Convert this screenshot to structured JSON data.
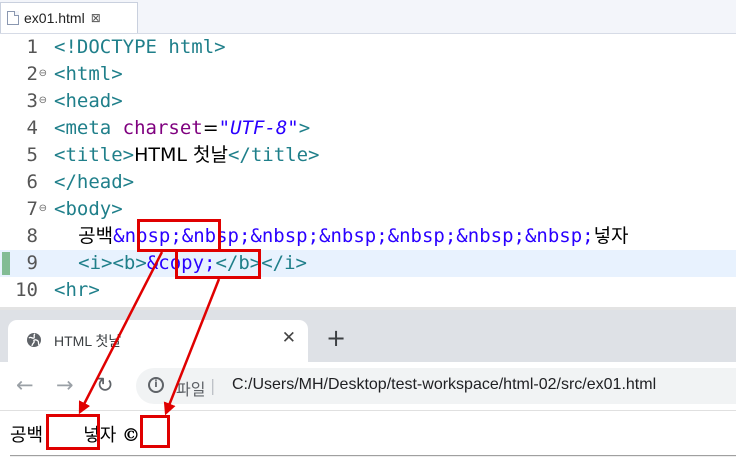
{
  "editor": {
    "tab": {
      "title": "ex01.html",
      "close": "⊠"
    },
    "lines": [
      {
        "num": "1",
        "tokens": [
          {
            "t": "<!DOCTYPE html>",
            "c": "tag"
          }
        ]
      },
      {
        "num": "2",
        "fold": true,
        "tokens": [
          {
            "t": "<html>",
            "c": "tag"
          }
        ]
      },
      {
        "num": "3",
        "fold": true,
        "tokens": [
          {
            "t": "<head>",
            "c": "tag"
          }
        ]
      },
      {
        "num": "4",
        "tokens": [
          {
            "t": "<meta ",
            "c": "tag"
          },
          {
            "t": "charset",
            "c": "attr"
          },
          {
            "t": "=",
            "c": "txt"
          },
          {
            "t": "\"UTF-8\"",
            "c": "val"
          },
          {
            "t": ">",
            "c": "tag"
          }
        ]
      },
      {
        "num": "5",
        "tokens": [
          {
            "t": "<title>",
            "c": "tag"
          },
          {
            "t": "HTML 첫날",
            "c": "txt"
          },
          {
            "t": "</title>",
            "c": "tag"
          }
        ]
      },
      {
        "num": "6",
        "tokens": [
          {
            "t": "</head>",
            "c": "tag"
          }
        ]
      },
      {
        "num": "7",
        "fold": true,
        "tokens": [
          {
            "t": "<body>",
            "c": "tag"
          }
        ]
      },
      {
        "num": "8",
        "tokens": [
          {
            "t": "    ",
            "c": "txt"
          },
          {
            "t": "공백",
            "c": "txt"
          },
          {
            "t": "&nbsp;&nbsp;&nbsp;&nbsp;&nbsp;&nbsp;&nbsp;",
            "c": "ent"
          },
          {
            "t": "넣자",
            "c": "txt"
          }
        ]
      },
      {
        "num": "9",
        "current": true,
        "marker": true,
        "tokens": [
          {
            "t": "    ",
            "c": "txt"
          },
          {
            "t": "<i><b>",
            "c": "tag"
          },
          {
            "t": "&copy;",
            "c": "ent"
          },
          {
            "t": "</b></i>",
            "c": "tag"
          }
        ]
      },
      {
        "num": "10",
        "tokens": [
          {
            "t": "<hr>",
            "c": "tag"
          }
        ]
      }
    ]
  },
  "browser": {
    "tab": {
      "title": "HTML 첫날",
      "close": "✕"
    },
    "new_tab": "+",
    "nav": {
      "back": "←",
      "forward": "→",
      "reload": "↻"
    },
    "address": {
      "scheme_label": "파일",
      "separator": "|",
      "url": "C:/Users/MH/Desktop/test-workspace/html-02/src/ex01.html"
    },
    "content": {
      "before": "공백",
      "spaces": "       ",
      "after": "넣자",
      "symbol": "©"
    }
  },
  "annotation_color": "#e00000"
}
